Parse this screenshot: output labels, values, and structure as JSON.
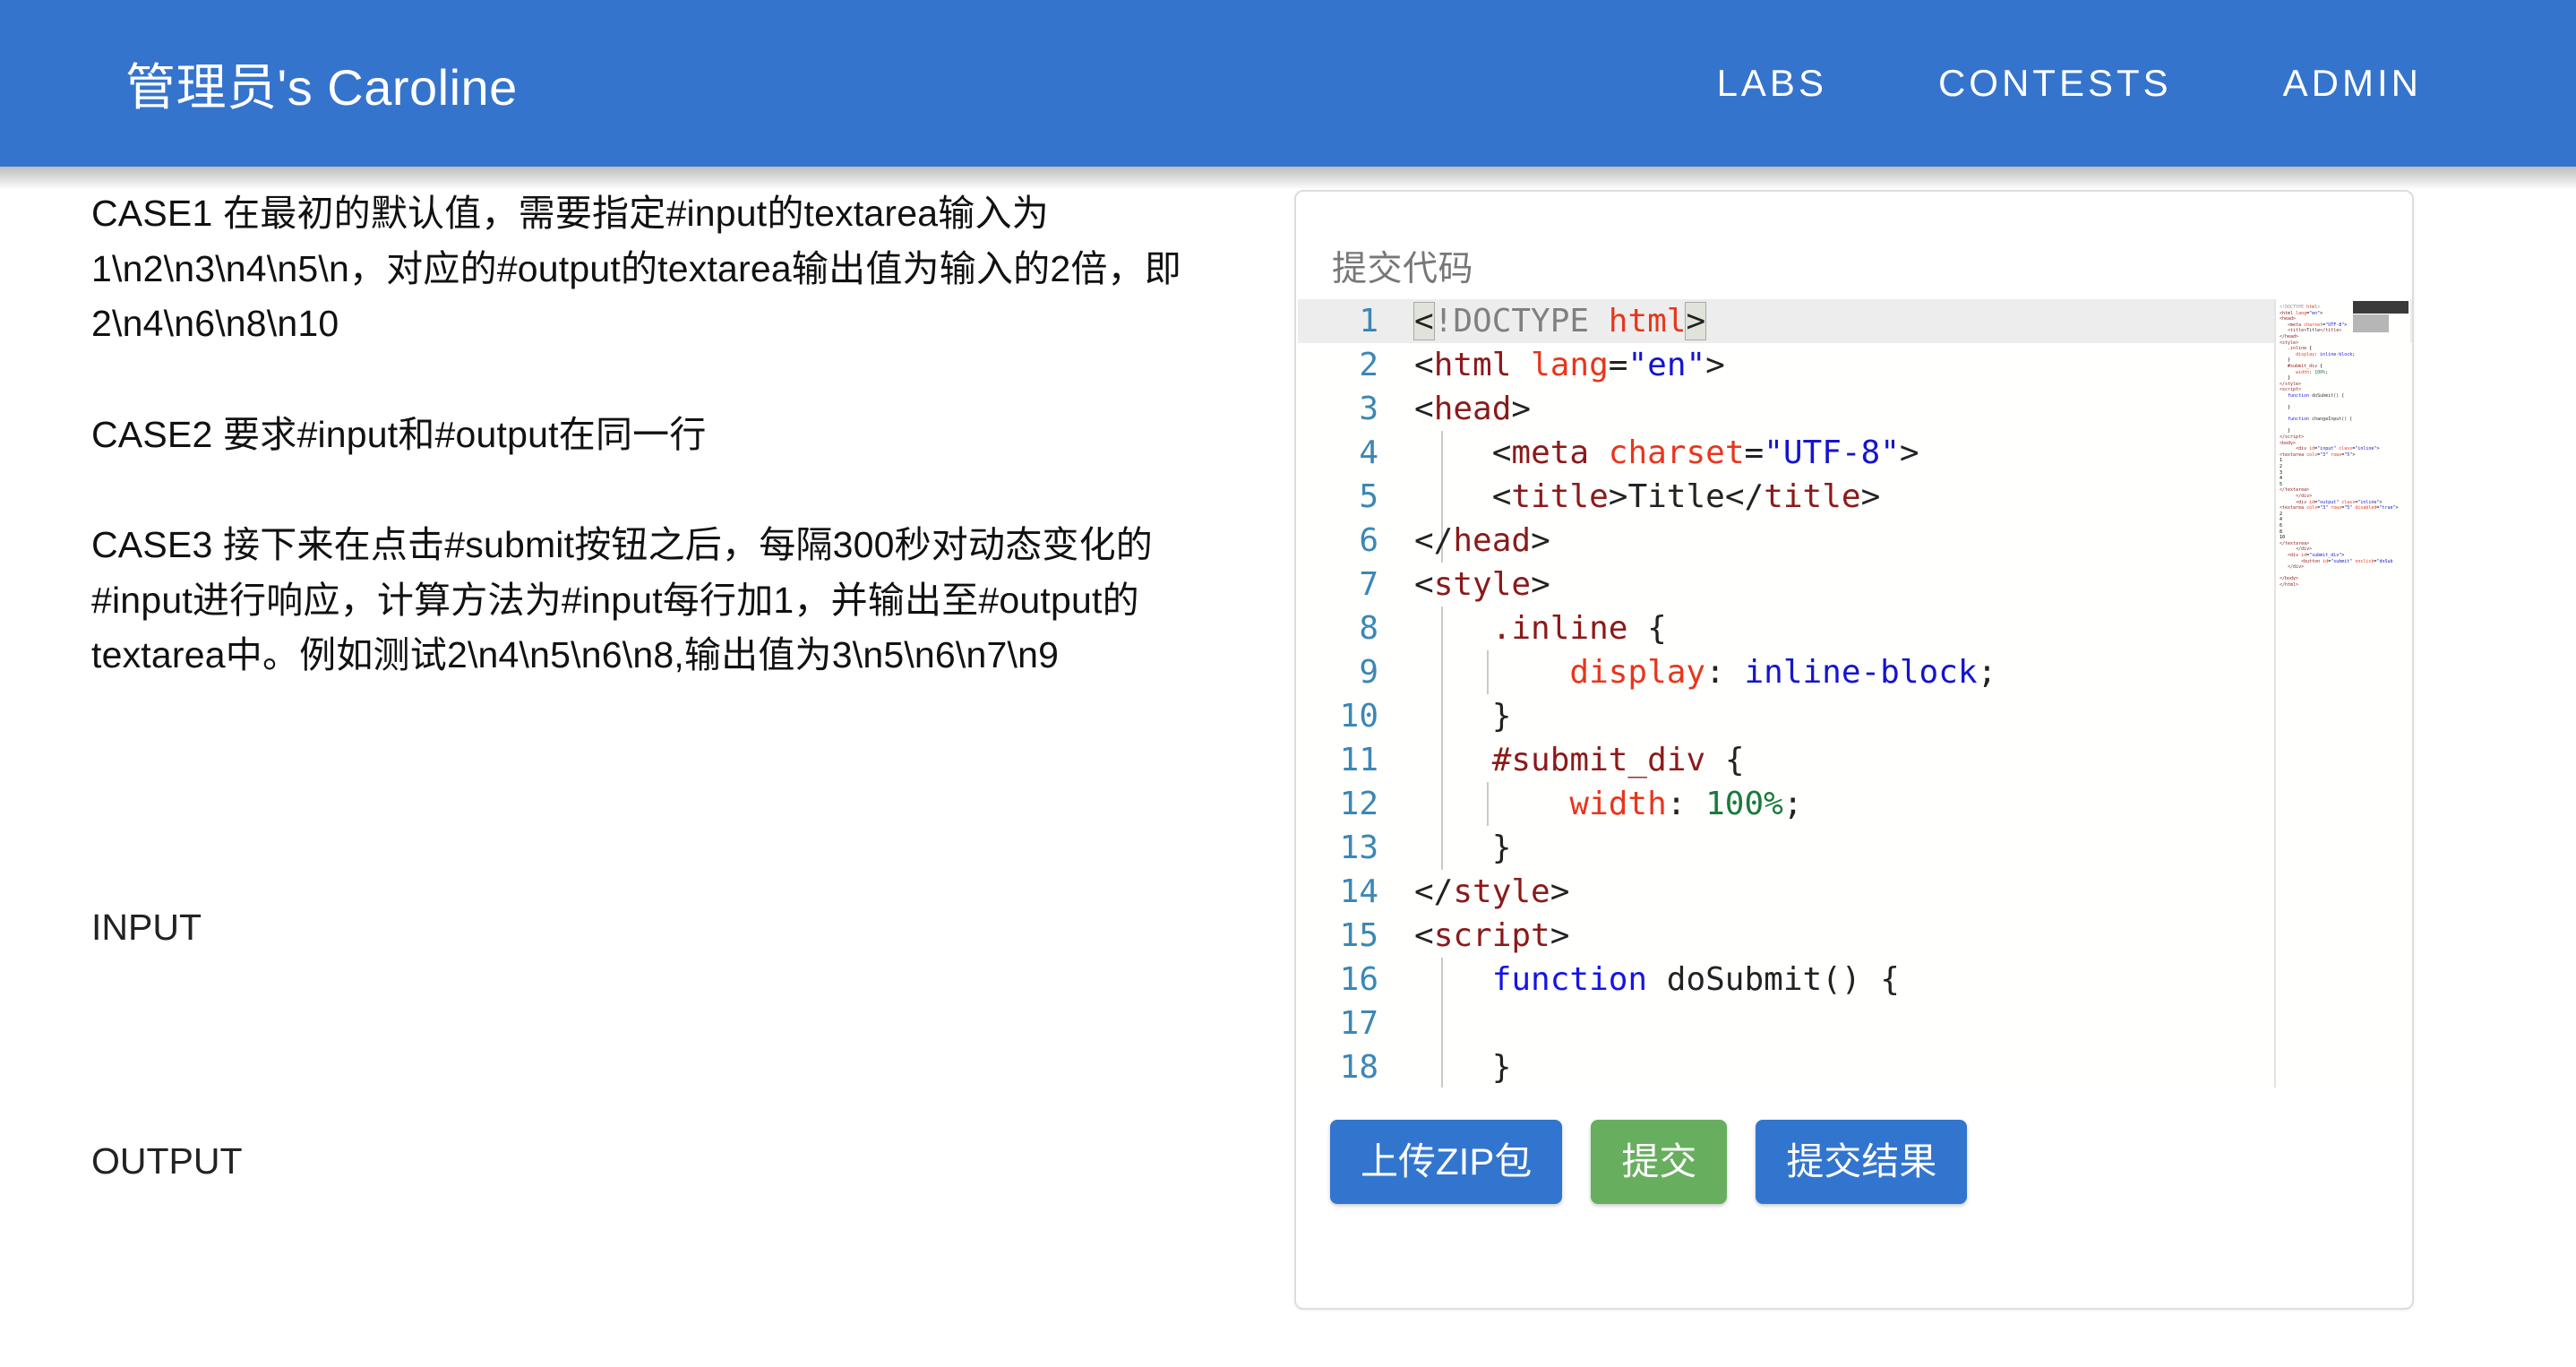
{
  "navbar": {
    "brand": "管理员's Caroline",
    "links": [
      {
        "label": "LABS"
      },
      {
        "label": "CONTESTS"
      },
      {
        "label": "ADMIN"
      }
    ]
  },
  "left_panel": {
    "paragraphs": [
      "CASE1 在最初的默认值，需要指定#input的textarea输入为1\\n2\\n3\\n4\\n5\\n，对应的#output的textarea输出值为输入的2倍，即2\\n4\\n6\\n8\\n10",
      "CASE2 要求#input和#output在同一行",
      "CASE3 接下来在点击#submit按钮之后，每隔300秒对动态变化的#input进行响应，计算方法为#input每行加1，并输出至#output的textarea中。例如测试2\\n4\\n5\\n6\\n8,输出值为3\\n5\\n6\\n7\\n9"
    ],
    "input_label": "INPUT",
    "output_label": "OUTPUT"
  },
  "card": {
    "label": "提交代码",
    "editor": {
      "active_line": 1,
      "lines": [
        {
          "n": "1",
          "text": "<!DOCTYPE html>"
        },
        {
          "n": "2",
          "text": "<html lang=\"en\">"
        },
        {
          "n": "3",
          "text": "<head>"
        },
        {
          "n": "4",
          "text": "    <meta charset=\"UTF-8\">"
        },
        {
          "n": "5",
          "text": "    <title>Title</title>"
        },
        {
          "n": "6",
          "text": "</head>"
        },
        {
          "n": "7",
          "text": "<style>"
        },
        {
          "n": "8",
          "text": "    .inline {"
        },
        {
          "n": "9",
          "text": "        display: inline-block;"
        },
        {
          "n": "10",
          "text": "    }"
        },
        {
          "n": "11",
          "text": "    #submit_div {"
        },
        {
          "n": "12",
          "text": "        width: 100%;"
        },
        {
          "n": "13",
          "text": "    }"
        },
        {
          "n": "14",
          "text": "</style>"
        },
        {
          "n": "15",
          "text": "<script>"
        },
        {
          "n": "16",
          "text": "    function doSubmit() {"
        },
        {
          "n": "17",
          "text": ""
        },
        {
          "n": "18",
          "text": "    }"
        }
      ]
    },
    "buttons": [
      {
        "label": "上传ZIP包",
        "color": "#3275ce"
      },
      {
        "label": "提交",
        "color": "#67ae5e"
      },
      {
        "label": "提交结果",
        "color": "#3275ce"
      }
    ]
  },
  "colors": {
    "navbar_blue": "#3574cd",
    "button_blue": "#3275ce",
    "button_green": "#67ae5e",
    "active_line": "#ededed",
    "line_number": "#3b87b5",
    "tag": "#8b1a1a",
    "attribute": "#e8361c",
    "string": "#1414cf",
    "keyword": "#1414e8",
    "number": "#1a7a3c",
    "doctype": "#808080"
  }
}
